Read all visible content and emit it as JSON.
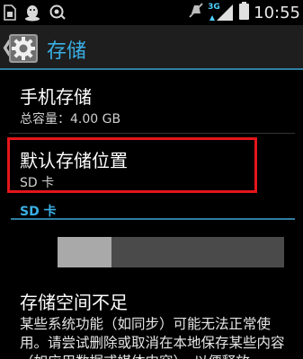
{
  "status_bar": {
    "time": "10:55",
    "network_label": "3G",
    "icons": [
      "sim-card-icon",
      "qq-penguin-icon",
      "chat-bubble-icon",
      "mute-icon",
      "signal-icon",
      "battery-icon"
    ]
  },
  "action_bar": {
    "title": "存储",
    "icon": "settings-gear-icon"
  },
  "phone_storage": {
    "title": "手机存储",
    "total": "总容量：4.00 GB"
  },
  "default_location": {
    "title": "默认存储位置",
    "value": "SD 卡"
  },
  "sd_card": {
    "header": "SD 卡",
    "usage_fraction": 0.24
  },
  "low_space": {
    "title": "存储空间不足",
    "text": "某些系统功能（如同步）可能无法正常使用。请尝试删除或取消在本地保存某些内容（如应用数据或媒体内容），以便释放"
  },
  "colors": {
    "accent": "#3ab0e6",
    "highlight": "#e3161b"
  }
}
